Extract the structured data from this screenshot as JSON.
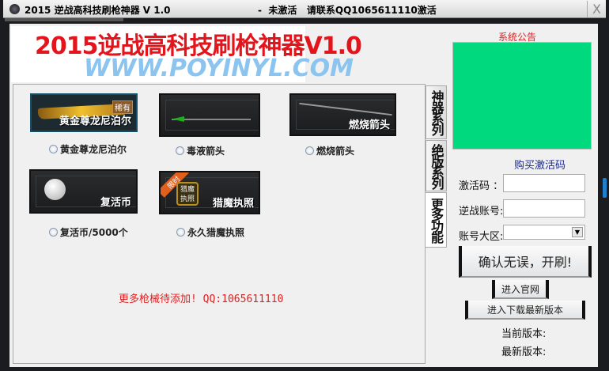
{
  "window": {
    "title": "2015 逆战高科技刷枪神器 V 1.0",
    "status": "-  未激活   请联系QQ1065611110激活",
    "close": "X"
  },
  "banner": {
    "title": "2015逆战高科技刷枪神器V1.0",
    "url": "WWW.POYINYL.COM"
  },
  "tabs": [
    {
      "label": "神器系列"
    },
    {
      "label": "绝版系列"
    },
    {
      "label": "更多功能",
      "selected": true
    }
  ],
  "items": [
    {
      "caption": "黄金尊龙尼泊尔",
      "badge": "稀有",
      "label": "黄金尊龙尼泊尔",
      "selected": false
    },
    {
      "caption": "",
      "label": "毒液箭头",
      "selected": false
    },
    {
      "caption": "燃烧箭头",
      "label": "燃烧箭头",
      "selected": false
    },
    {
      "caption": "复活币",
      "label": "复活币/5000个",
      "selected": false
    },
    {
      "caption": "猎魔执照",
      "badge": "限时",
      "emblem": "猎魔执照",
      "label": "永久猎魔执照",
      "selected": false
    }
  ],
  "more_text": "更多枪械待添加! QQ:1065611110",
  "sidebar": {
    "notice_label": "系统公告",
    "buy_link": "购买激活码",
    "activation_label": "激活码 ：",
    "activation_value": "",
    "account_label": "逆战账号:",
    "account_value": "",
    "region_label": "账号大区:",
    "region_value": "",
    "start_button": "确认无误，开刷!",
    "website_button": "进入官网",
    "download_button": "进入下载最新版本",
    "current_version_label": "当前版本:",
    "latest_version_label": "最新版本:"
  },
  "colors": {
    "notice_bg": "#00d97d",
    "banner_red": "#e3141b",
    "banner_blue": "#8cc4f0"
  }
}
